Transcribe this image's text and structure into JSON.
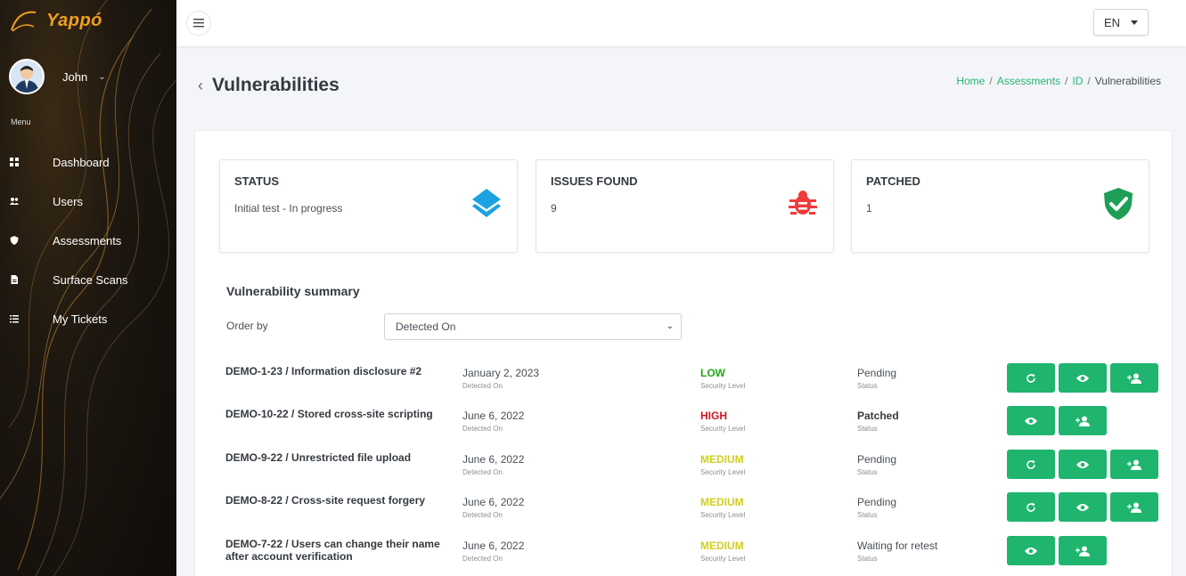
{
  "app": {
    "logo_text": "Yappó",
    "lang": "EN"
  },
  "user": {
    "name": "John"
  },
  "sidebar": {
    "menu_label": "Menu",
    "items": [
      {
        "label": "Dashboard",
        "icon": "dashboard-icon"
      },
      {
        "label": "Users",
        "icon": "users-icon"
      },
      {
        "label": "Assessments",
        "icon": "shield-icon"
      },
      {
        "label": "Surface Scans",
        "icon": "document-icon"
      },
      {
        "label": "My Tickets",
        "icon": "list-icon"
      }
    ]
  },
  "page": {
    "title": "Vulnerabilities"
  },
  "breadcrumb": {
    "home": "Home",
    "assessments": "Assessments",
    "id": "ID",
    "current": "Vulnerabilities"
  },
  "stats": {
    "status": {
      "title": "STATUS",
      "value": "Initial test - In progress",
      "icon": "layers-icon"
    },
    "issues": {
      "title": "ISSUES FOUND",
      "value": "9",
      "icon": "bug-icon"
    },
    "patched": {
      "title": "PATCHED",
      "value": "1",
      "icon": "shield-check-icon"
    }
  },
  "summary": {
    "title": "Vulnerability summary",
    "order_label": "Order by",
    "order_value": "Detected On",
    "detected_label": "Detected On",
    "level_label": "Security Level",
    "status_label": "Status"
  },
  "colors": {
    "accent": "#1fb56f",
    "low": "#22a614",
    "high": "#d0141e",
    "medium": "#d1cf1d"
  },
  "vulnerabilities": [
    {
      "title": "DEMO-1-23 / Information disclosure #2",
      "date": "January 2, 2023",
      "level": "LOW",
      "status": "Pending",
      "actions": [
        "retest",
        "view",
        "assign"
      ]
    },
    {
      "title": "DEMO-10-22 / Stored cross-site scripting",
      "date": "June 6, 2022",
      "level": "HIGH",
      "status": "Patched",
      "actions": [
        "view",
        "assign"
      ]
    },
    {
      "title": "DEMO-9-22 / Unrestricted file upload",
      "date": "June 6, 2022",
      "level": "MEDIUM",
      "status": "Pending",
      "actions": [
        "retest",
        "view",
        "assign"
      ]
    },
    {
      "title": "DEMO-8-22 / Cross-site request forgery",
      "date": "June 6, 2022",
      "level": "MEDIUM",
      "status": "Pending",
      "actions": [
        "retest",
        "view",
        "assign"
      ]
    },
    {
      "title": "DEMO-7-22 / Users can change their name after account verification",
      "date": "June 6, 2022",
      "level": "MEDIUM",
      "status": "Waiting for retest",
      "actions": [
        "view",
        "assign"
      ]
    }
  ]
}
